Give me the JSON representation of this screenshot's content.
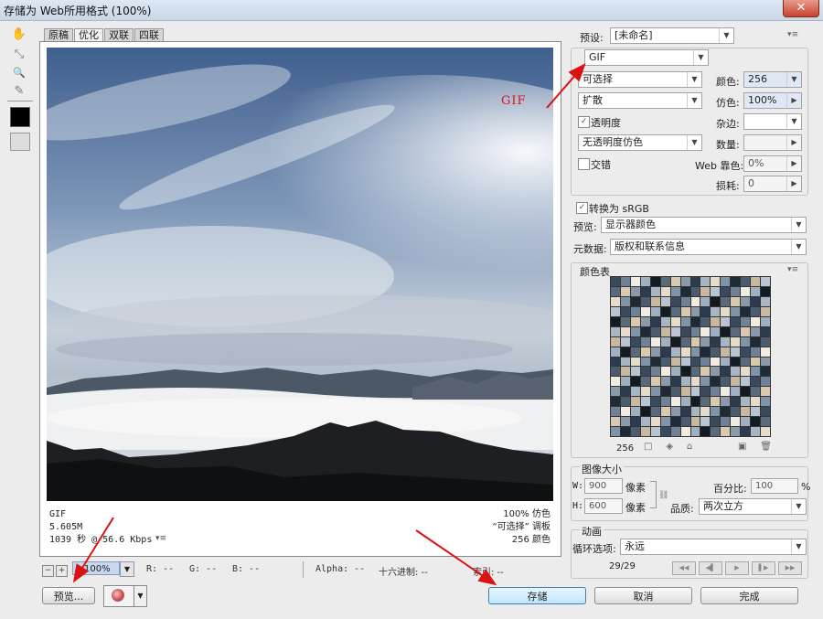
{
  "window": {
    "title": "存储为 Web所用格式 (100%)",
    "close_glyph": "✕"
  },
  "toolbox": {
    "tools": [
      {
        "name": "hand-tool",
        "glyph": "✋"
      },
      {
        "name": "slice-select-tool",
        "glyph": "⤡"
      },
      {
        "name": "zoom-tool",
        "glyph": "🔍"
      },
      {
        "name": "eyedropper-tool",
        "glyph": "✎"
      }
    ],
    "swatch_color": "#000000"
  },
  "tabs": [
    "原稿",
    "优化",
    "双联",
    "四联"
  ],
  "active_tab": "优化",
  "preview_info": {
    "format": "GIF",
    "size": "5.605M",
    "speed": "1039 秒 @ 56.6 Kbps",
    "speed_menu": "▾≡",
    "dither": "100% 仿色",
    "palette": "“可选择” 调板",
    "colors": "256 颜色"
  },
  "status_bar": {
    "zoom_minus": "−",
    "zoom_plus": "+",
    "zoom": "100%",
    "r": "R: --",
    "g": "G: --",
    "b": "B: --",
    "alpha": "Alpha: --",
    "hex": "十六进制: --",
    "index": "索引: --"
  },
  "buttons": {
    "preview": "预览...",
    "save": "存储",
    "cancel": "取消",
    "done": "完成"
  },
  "settings": {
    "preset_label": "预设:",
    "preset_value": "[未命名]",
    "format_value": "GIF",
    "palette_value": "可选择",
    "dither_algo_value": "扩散",
    "transparency_label": "透明度",
    "transparency_dither_value": "无透明度仿色",
    "interlaced_label": "交错",
    "colors_label": "颜色:",
    "colors_value": "256",
    "dither_label": "仿色:",
    "dither_value": "100%",
    "matte_label": "杂边:",
    "amount_label": "数量:",
    "web_snap_label": "Web 靠色:",
    "web_snap_value": "0%",
    "lossy_label": "损耗:",
    "lossy_value": "0",
    "convert_srgb_label": "转换为 sRGB",
    "preview_label": "预览:",
    "preview_value": "显示器颜色",
    "metadata_label": "元数据:",
    "metadata_value": "版权和联系信息"
  },
  "color_table": {
    "title": "颜色表",
    "count": "256",
    "colors": [
      "#3a4a5e",
      "#8a9aaa",
      "#c9b8a0",
      "#5a6a7e",
      "#1e2a38",
      "#9fb0c2",
      "#e6dccb",
      "#6f8196",
      "#2c3b4d",
      "#b8c4d1",
      "#d9c9ae",
      "#4b5b70",
      "#141a22",
      "#7f93a9",
      "#f1ece2",
      "#a7b5c4"
    ],
    "icons": [
      "□",
      "◈",
      "⌂",
      "▣",
      "🗑"
    ]
  },
  "image_size": {
    "title": "图像大小",
    "w_label": "W:",
    "w_value": "900",
    "w_unit": "像素",
    "h_label": "H:",
    "h_value": "600",
    "h_unit": "像素",
    "percent_label": "百分比:",
    "percent_value": "100",
    "percent_unit": "%",
    "quality_label": "品质:",
    "quality_value": "两次立方"
  },
  "animation": {
    "title": "动画",
    "loop_label": "循环选项:",
    "loop_value": "永远",
    "frame": "29/29"
  },
  "annotations": {
    "gif_label": "GIF",
    "color": "#dd1111"
  }
}
